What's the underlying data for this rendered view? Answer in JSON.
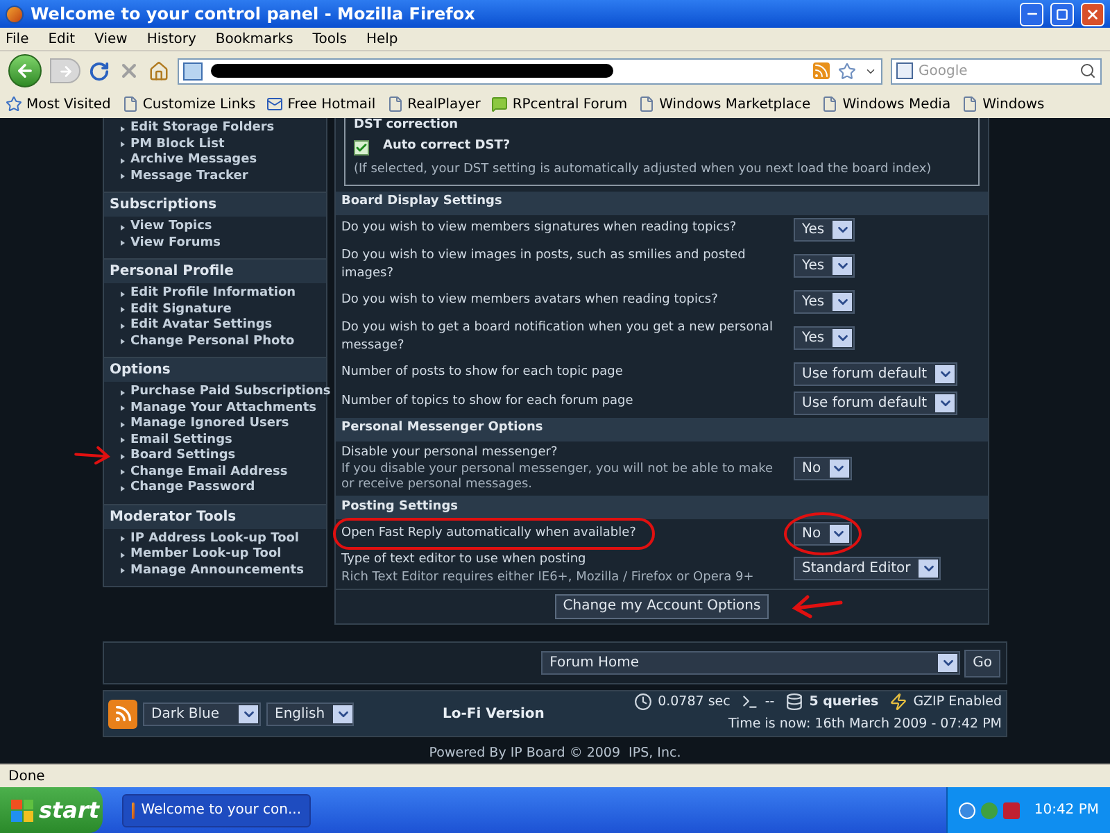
{
  "window": {
    "title": "Welcome to your control panel - Mozilla Firefox"
  },
  "menu": [
    "File",
    "Edit",
    "View",
    "History",
    "Bookmarks",
    "Tools",
    "Help"
  ],
  "search": {
    "placeholder": "Google"
  },
  "bookmarks": [
    {
      "label": "Most Visited",
      "kind": "smart"
    },
    {
      "label": "Customize Links",
      "kind": "page"
    },
    {
      "label": "Free Hotmail",
      "kind": "mail"
    },
    {
      "label": "RealPlayer",
      "kind": "page"
    },
    {
      "label": "RPcentral Forum",
      "kind": "chat"
    },
    {
      "label": "Windows Marketplace",
      "kind": "page"
    },
    {
      "label": "Windows Media",
      "kind": "page"
    },
    {
      "label": "Windows",
      "kind": "page"
    }
  ],
  "sidebar": [
    {
      "items": [
        {
          "label": "Edit Storage Folders",
          "arrow": false
        },
        {
          "label": "PM Block List",
          "arrow": false
        },
        {
          "label": "Archive Messages",
          "arrow": false
        },
        {
          "label": "Message Tracker",
          "arrow": false
        }
      ]
    },
    {
      "title": "Subscriptions",
      "items": [
        {
          "label": "View Topics",
          "arrow": false
        },
        {
          "label": "View Forums",
          "arrow": false
        }
      ]
    },
    {
      "title": "Personal Profile",
      "items": [
        {
          "label": "Edit Profile Information",
          "arrow": false
        },
        {
          "label": "Edit Signature",
          "arrow": false
        },
        {
          "label": "Edit Avatar Settings",
          "arrow": false
        },
        {
          "label": "Change Personal Photo",
          "arrow": false
        }
      ]
    },
    {
      "title": "Options",
      "items": [
        {
          "label": "Purchase Paid Subscriptions",
          "arrow": false
        },
        {
          "label": "Manage Your Attachments",
          "arrow": false
        },
        {
          "label": "Manage Ignored Users",
          "arrow": false
        },
        {
          "label": "Email Settings",
          "arrow": false
        },
        {
          "label": "Board Settings",
          "arrow": true
        },
        {
          "label": "Change Email Address",
          "arrow": false
        },
        {
          "label": "Change Password",
          "arrow": false
        }
      ]
    },
    {
      "title": "Moderator Tools",
      "items": [
        {
          "label": "IP Address Look-up Tool",
          "arrow": false
        },
        {
          "label": "Member Look-up Tool",
          "arrow": false
        },
        {
          "label": "Manage Announcements",
          "arrow": false
        }
      ]
    }
  ],
  "dst": {
    "legend": "DST correction",
    "label": "Auto correct DST?",
    "checked": true,
    "hint": "(If selected, your DST setting is automatically adjusted when you next load the board index)"
  },
  "sections": [
    {
      "title": "Board Display Settings",
      "rows": [
        {
          "question": "Do you wish to view members signatures when reading topics?",
          "value": "Yes",
          "circled": false
        },
        {
          "question": "Do you wish to view images in posts, such as smilies and posted images?",
          "value": "Yes",
          "circled": false
        },
        {
          "question": "Do you wish to view members avatars when reading topics?",
          "value": "Yes",
          "circled": false
        },
        {
          "question": "Do you wish to get a board notification when you get a new personal message?",
          "value": "Yes",
          "circled": false
        },
        {
          "question": "Number of posts to show for each topic page",
          "value": "Use forum default",
          "circled": false
        },
        {
          "question": "Number of topics to show for each forum page",
          "value": "Use forum default",
          "circled": false
        }
      ]
    },
    {
      "title": "Personal Messenger Options",
      "rows": [
        {
          "question": "Disable your personal messenger?",
          "note": "If you disable your personal messenger, you will not be able to make or receive personal messages.",
          "value": "No",
          "circled": false
        }
      ]
    },
    {
      "title": "Posting Settings",
      "rows": [
        {
          "question": "Open Fast Reply automatically when available?",
          "value": "No",
          "circled": true
        },
        {
          "question": "Type of text editor to use when posting",
          "note": "Rich Text Editor requires either IE6+, Mozilla / Firefox or Opera 9+",
          "value": "Standard Editor",
          "circled": false
        }
      ]
    }
  ],
  "submit": {
    "label": "Change my Account Options",
    "arrow": true
  },
  "jump": {
    "value": "Forum Home",
    "go": "Go"
  },
  "footer": {
    "skin": "Dark Blue",
    "language": "English",
    "lofi": "Lo-Fi Version",
    "stats": [
      {
        "kind": "time",
        "text": "0.0787 sec"
      },
      {
        "kind": "sql",
        "text": "--"
      },
      {
        "kind": "queries",
        "text": "5 queries"
      },
      {
        "kind": "gzip",
        "text": "GZIP Enabled"
      }
    ],
    "clock": "Time is now: 16th March 2009 - 07:42 PM"
  },
  "powered": "Powered By IP Board © 2009  IPS, Inc.",
  "status": "Done",
  "taskbar": {
    "start": "start",
    "task": "Welcome to your con...",
    "time": "10:42 PM"
  }
}
